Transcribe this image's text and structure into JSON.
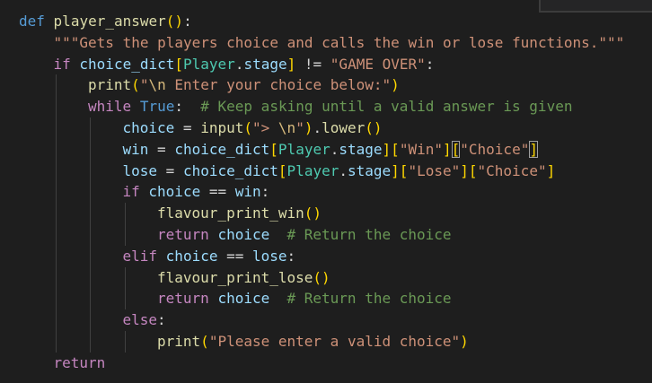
{
  "editor": {
    "language": "python",
    "lines": [
      {
        "tokens": [
          {
            "t": "def",
            "c": "kw"
          },
          {
            "t": " "
          },
          {
            "t": "player_answer",
            "c": "fn"
          },
          {
            "t": "(",
            "c": "p1"
          },
          {
            "t": ")",
            "c": "p1"
          },
          {
            "t": ":"
          }
        ]
      },
      {
        "tokens": [
          {
            "t": "\"\"\"Gets the players choice and calls the win or lose functions.\"\"\"",
            "c": "str"
          }
        ]
      },
      {
        "tokens": [
          {
            "t": "if",
            "c": "ctl"
          },
          {
            "t": " "
          },
          {
            "t": "choice_dict",
            "c": "var"
          },
          {
            "t": "[",
            "c": "p1"
          },
          {
            "t": "Player",
            "c": "cls"
          },
          {
            "t": "."
          },
          {
            "t": "stage",
            "c": "var"
          },
          {
            "t": "]",
            "c": "p1"
          },
          {
            "t": " != "
          },
          {
            "t": "\"GAME OVER\"",
            "c": "str"
          },
          {
            "t": ":"
          }
        ]
      },
      {
        "tokens": [
          {
            "t": "print",
            "c": "fn"
          },
          {
            "t": "(",
            "c": "p1"
          },
          {
            "t": "\"",
            "c": "str"
          },
          {
            "t": "\\n",
            "c": "esc"
          },
          {
            "t": " Enter your choice below:\"",
            "c": "str"
          },
          {
            "t": ")",
            "c": "p1"
          }
        ]
      },
      {
        "tokens": [
          {
            "t": "while",
            "c": "ctl"
          },
          {
            "t": " "
          },
          {
            "t": "True",
            "c": "kw"
          },
          {
            "t": ":  "
          },
          {
            "t": "# Keep asking until a valid answer is given",
            "c": "cmt"
          }
        ]
      },
      {
        "tokens": [
          {
            "t": "choice",
            "c": "var"
          },
          {
            "t": " = "
          },
          {
            "t": "input",
            "c": "fn"
          },
          {
            "t": "(",
            "c": "p1"
          },
          {
            "t": "\"> ",
            "c": "str"
          },
          {
            "t": "\\n",
            "c": "esc"
          },
          {
            "t": "\"",
            "c": "str"
          },
          {
            "t": ")",
            "c": "p1"
          },
          {
            "t": "."
          },
          {
            "t": "lower",
            "c": "fn"
          },
          {
            "t": "(",
            "c": "p1"
          },
          {
            "t": ")",
            "c": "p1"
          }
        ]
      },
      {
        "tokens": [
          {
            "t": "win",
            "c": "var"
          },
          {
            "t": " = "
          },
          {
            "t": "choice_dict",
            "c": "var"
          },
          {
            "t": "[",
            "c": "p1"
          },
          {
            "t": "Player",
            "c": "cls"
          },
          {
            "t": "."
          },
          {
            "t": "stage",
            "c": "var"
          },
          {
            "t": "]",
            "c": "p1"
          },
          {
            "t": "[",
            "c": "p1"
          },
          {
            "t": "\"Win\"",
            "c": "str"
          },
          {
            "t": "]",
            "c": "p1"
          },
          {
            "t": "[",
            "c": "p1",
            "box": true
          },
          {
            "t": "\"Choice\"",
            "c": "str"
          },
          {
            "t": "]",
            "c": "p1",
            "box": true
          }
        ]
      },
      {
        "tokens": [
          {
            "t": "lose",
            "c": "var"
          },
          {
            "t": " = "
          },
          {
            "t": "choice_dict",
            "c": "var"
          },
          {
            "t": "[",
            "c": "p1"
          },
          {
            "t": "Player",
            "c": "cls"
          },
          {
            "t": "."
          },
          {
            "t": "stage",
            "c": "var"
          },
          {
            "t": "]",
            "c": "p1"
          },
          {
            "t": "[",
            "c": "p1"
          },
          {
            "t": "\"Lose\"",
            "c": "str"
          },
          {
            "t": "]",
            "c": "p1"
          },
          {
            "t": "[",
            "c": "p1"
          },
          {
            "t": "\"Choice\"",
            "c": "str"
          },
          {
            "t": "]",
            "c": "p1"
          }
        ]
      },
      {
        "tokens": [
          {
            "t": "if",
            "c": "ctl"
          },
          {
            "t": " "
          },
          {
            "t": "choice",
            "c": "var"
          },
          {
            "t": " == "
          },
          {
            "t": "win",
            "c": "var"
          },
          {
            "t": ":"
          }
        ]
      },
      {
        "tokens": [
          {
            "t": "flavour_print_win",
            "c": "fn"
          },
          {
            "t": "(",
            "c": "p1"
          },
          {
            "t": ")",
            "c": "p1"
          }
        ]
      },
      {
        "tokens": [
          {
            "t": "return",
            "c": "ctl"
          },
          {
            "t": " "
          },
          {
            "t": "choice",
            "c": "var"
          },
          {
            "t": "  "
          },
          {
            "t": "# Return the choice",
            "c": "cmt"
          }
        ]
      },
      {
        "tokens": [
          {
            "t": "elif",
            "c": "ctl"
          },
          {
            "t": " "
          },
          {
            "t": "choice",
            "c": "var"
          },
          {
            "t": " == "
          },
          {
            "t": "lose",
            "c": "var"
          },
          {
            "t": ":"
          }
        ]
      },
      {
        "tokens": [
          {
            "t": "flavour_print_lose",
            "c": "fn"
          },
          {
            "t": "(",
            "c": "p1"
          },
          {
            "t": ")",
            "c": "p1"
          }
        ]
      },
      {
        "tokens": [
          {
            "t": "return",
            "c": "ctl"
          },
          {
            "t": " "
          },
          {
            "t": "choice",
            "c": "var"
          },
          {
            "t": "  "
          },
          {
            "t": "# Return the choice",
            "c": "cmt"
          }
        ]
      },
      {
        "tokens": [
          {
            "t": "else",
            "c": "ctl"
          },
          {
            "t": ":"
          }
        ]
      },
      {
        "tokens": [
          {
            "t": "print",
            "c": "fn"
          },
          {
            "t": "(",
            "c": "p1"
          },
          {
            "t": "\"Please enter a valid choice\"",
            "c": "str"
          },
          {
            "t": ")",
            "c": "p1"
          }
        ]
      },
      {
        "tokens": [
          {
            "t": "return",
            "c": "ctl"
          }
        ]
      }
    ]
  }
}
